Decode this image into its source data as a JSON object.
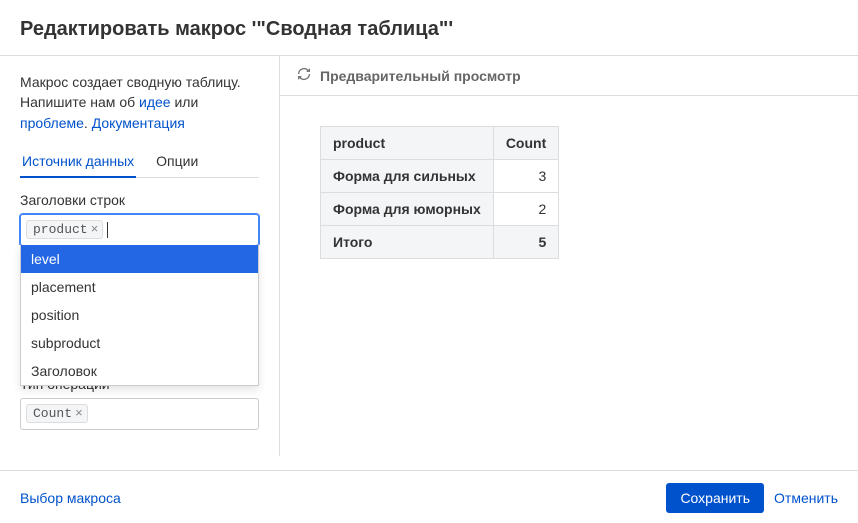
{
  "header": {
    "title": "Редактировать макрос '\"Сводная таблица\"'"
  },
  "intro": {
    "text_before_idea": "Макрос создает сводную таблицу. Напишите нам об ",
    "idea_link": "идее",
    "text_between": " или ",
    "problem_link": "проблеме",
    "text_after_problem": ". ",
    "doc_link": "Документация"
  },
  "tabs": {
    "data_source": "Источник данных",
    "options": "Опции"
  },
  "fields": {
    "row_headers_label": "Заголовки строк",
    "row_headers_tag": "product",
    "operation_type_label": "Тип операции",
    "operation_type_tag": "Count"
  },
  "dropdown": {
    "items": [
      "level",
      "placement",
      "position",
      "subproduct",
      "Заголовок"
    ],
    "highlighted_index": 0
  },
  "preview": {
    "header": "Предварительный просмотр",
    "table": {
      "col1": "product",
      "col2": "Count",
      "rows": [
        {
          "label": "Форма для сильных",
          "value": "3"
        },
        {
          "label": "Форма для юморных",
          "value": "2"
        }
      ],
      "total_label": "Итого",
      "total_value": "5"
    }
  },
  "footer": {
    "select_macro": "Выбор макроса",
    "save": "Сохранить",
    "cancel": "Отменить"
  }
}
